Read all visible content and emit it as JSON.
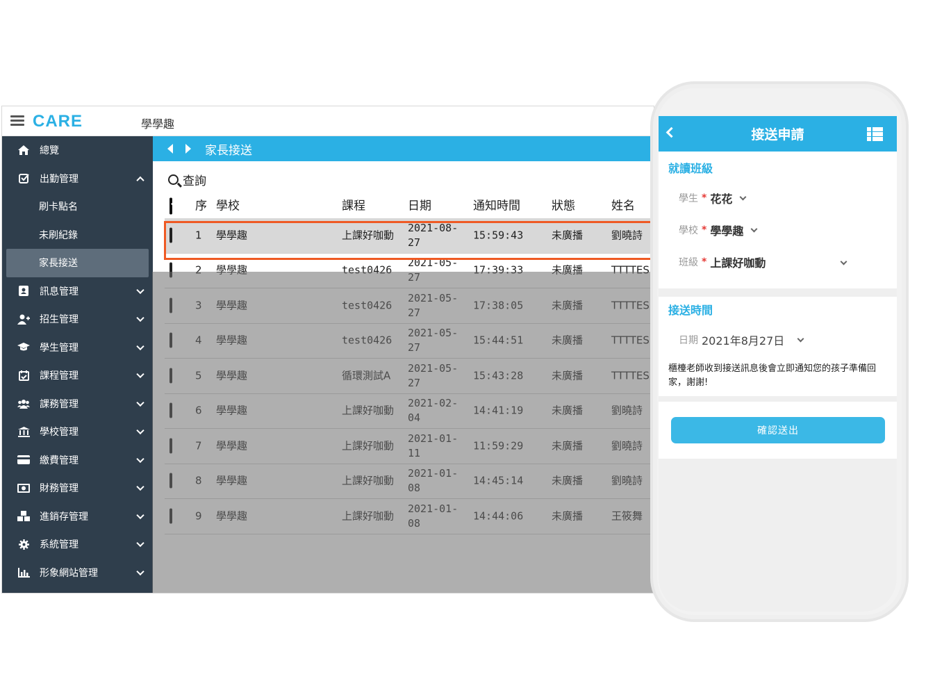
{
  "app": {
    "brand": "CARE",
    "school_title": "學學趣"
  },
  "sidebar": {
    "items": [
      {
        "label": "總覽",
        "icon": "home-icon"
      },
      {
        "label": "出勤管理",
        "icon": "check-square-icon",
        "expanded": true,
        "children": [
          {
            "label": "刷卡點名"
          },
          {
            "label": "未刷紀錄"
          },
          {
            "label": "家長接送",
            "active": true
          }
        ]
      },
      {
        "label": "訊息管理",
        "icon": "contact-icon"
      },
      {
        "label": "招生管理",
        "icon": "user-plus-icon"
      },
      {
        "label": "學生管理",
        "icon": "graduation-cap-icon"
      },
      {
        "label": "課程管理",
        "icon": "calendar-check-icon"
      },
      {
        "label": "課務管理",
        "icon": "users-icon"
      },
      {
        "label": "學校管理",
        "icon": "bank-icon"
      },
      {
        "label": "繳費管理",
        "icon": "credit-card-icon"
      },
      {
        "label": "財務管理",
        "icon": "money-icon"
      },
      {
        "label": "進銷存管理",
        "icon": "cubes-icon"
      },
      {
        "label": "系統管理",
        "icon": "gear-icon"
      },
      {
        "label": "形象網站管理",
        "icon": "bar-chart-icon"
      }
    ]
  },
  "main": {
    "breadcrumb": "家長接送",
    "query_label": "查詢",
    "table": {
      "headers": [
        "序",
        "學校",
        "課程",
        "日期",
        "通知時間",
        "狀態",
        "姓名"
      ],
      "rows": [
        {
          "idx": "1",
          "school": "學學趣",
          "course": "上課好咖動",
          "date": "2021-08-27",
          "time": "15:59:43",
          "status": "未廣播",
          "name": "劉曉詩"
        },
        {
          "idx": "2",
          "school": "學學趣",
          "course": "test0426",
          "date": "2021-05-27",
          "time": "17:39:33",
          "status": "未廣播",
          "name": "TTTTES"
        },
        {
          "idx": "3",
          "school": "學學趣",
          "course": "test0426",
          "date": "2021-05-27",
          "time": "17:38:05",
          "status": "未廣播",
          "name": "TTTTES"
        },
        {
          "idx": "4",
          "school": "學學趣",
          "course": "test0426",
          "date": "2021-05-27",
          "time": "15:44:51",
          "status": "未廣播",
          "name": "TTTTES"
        },
        {
          "idx": "5",
          "school": "學學趣",
          "course": "循環測試A",
          "date": "2021-05-27",
          "time": "15:43:28",
          "status": "未廣播",
          "name": "TTTTES"
        },
        {
          "idx": "6",
          "school": "學學趣",
          "course": "上課好咖動",
          "date": "2021-02-04",
          "time": "14:41:19",
          "status": "未廣播",
          "name": "劉曉詩"
        },
        {
          "idx": "7",
          "school": "學學趣",
          "course": "上課好咖動",
          "date": "2021-01-11",
          "time": "11:59:29",
          "status": "未廣播",
          "name": "劉曉詩"
        },
        {
          "idx": "8",
          "school": "學學趣",
          "course": "上課好咖動",
          "date": "2021-01-08",
          "time": "14:45:14",
          "status": "未廣播",
          "name": "劉曉詩"
        },
        {
          "idx": "9",
          "school": "學學趣",
          "course": "上課好咖動",
          "date": "2021-01-08",
          "time": "14:44:06",
          "status": "未廣播",
          "name": "王筱舞"
        }
      ]
    }
  },
  "phone": {
    "title": "接送申請",
    "section_class": "就讀班級",
    "student_label": "學生",
    "student_value": "花花",
    "school_label": "學校",
    "school_value": "學學趣",
    "class_label": "班級",
    "class_value": "上課好咖動",
    "section_time": "接送時間",
    "date_label": "日期",
    "date_value": "2021年8月27日",
    "note": "櫃檯老師收到接送訊息後會立即通知您的孩子準備回家，謝謝!",
    "submit_label": "確認送出",
    "required_mark": "*"
  },
  "colors": {
    "accent": "#2bb0e4",
    "sidebar_bg": "#2f3e4c",
    "highlight_border": "#ef5a24",
    "required": "#e53935"
  }
}
